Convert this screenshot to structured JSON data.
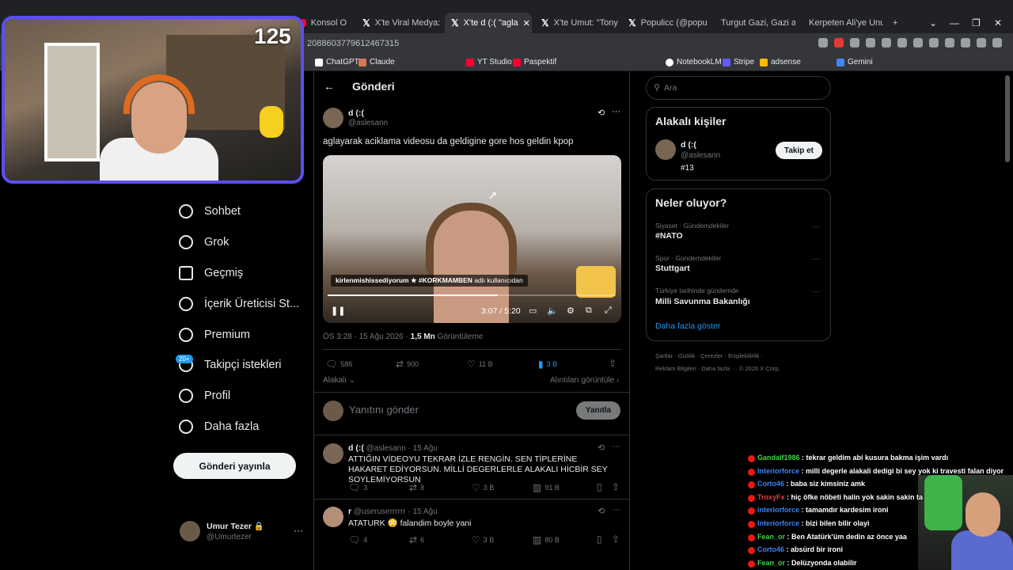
{
  "browser": {
    "tabs": [
      {
        "label": "Konsol O"
      },
      {
        "label": "X'te Viral Medya: \"Big"
      },
      {
        "label": "X'te d (:( \"agla"
      },
      {
        "label": "X'te Umut: \"Tony Sta"
      },
      {
        "label": "Populicc (@populicc)"
      },
      {
        "label": "Turgut Gazi, Gazi alp"
      },
      {
        "label": "Kerpeten Ali'ye Unutu"
      }
    ],
    "new_tab": "+",
    "url": "2088603779612467315",
    "bookmarks": [
      "ChatGPT",
      "Claude",
      "YT Studio",
      "Paspektif",
      "NotebookLM",
      "Stripe",
      "adsense",
      "Gemini"
    ]
  },
  "stream": {
    "counter": "125",
    "chat": [
      {
        "user": "Gandalf1986",
        "msg": ": tekrar geldim abi kusura bakma işim vardı",
        "color": "#3fd34a"
      },
      {
        "user": "Interiorforce",
        "msg": ": milli degerle alakali dedigi bi sey yok ki travesti falan diyor",
        "color": "#3b82f6"
      },
      {
        "user": "Corto46",
        "msg": ": baba siz kimsiniz amk",
        "color": "#3b82f6"
      },
      {
        "user": "TroxyFx",
        "msg": ": hiç öfke nöbeti halin yok sakin sakin ta",
        "color": "#e04040"
      },
      {
        "user": "interiorforce",
        "msg": ": tamamdır kardesim ironi",
        "color": "#3b82f6"
      },
      {
        "user": "Interiorforce",
        "msg": ": bizi bilen bilir olayi",
        "color": "#3b82f6"
      },
      {
        "user": "Fean_or",
        "msg": ": Ben Atatürk'üm dedin az önce yaa",
        "color": "#3fd34a"
      },
      {
        "user": "Corto46",
        "msg": ": absürd bir ironi",
        "color": "#3b82f6"
      },
      {
        "user": "Fean_or",
        "msg": ": Delüzyonda olabilir",
        "color": "#3fd34a"
      }
    ]
  },
  "nav": {
    "items": [
      "Sohbet",
      "Grok",
      "Geçmiş",
      "İçerik Üreticisi St...",
      "Premium",
      "Takipçi istekleri",
      "Profil",
      "Daha fazla"
    ],
    "badge": "20+",
    "post_button": "Gönderi yayınla",
    "account": {
      "name": "Umur Tezer 🔒",
      "handle": "@Umurtezer",
      "more": "···"
    }
  },
  "main": {
    "back": "←",
    "title": "Gönderi",
    "tweet": {
      "name": "d (:(",
      "handle": "@aslesann",
      "text": "aglayarak aciklama videosu da geldigine gore hos geldin kpop",
      "video": {
        "caption_prefix": "kirlenmishissediyorum ★ #KORKMAMBEN",
        "caption_suffix": "adlı kullanıcıdan",
        "time": "3:07 / 5:20",
        "progress": 0.59
      },
      "timestamp": "ÖS 3:28 · 15 Ağu 2026 ·",
      "views_count": "1,5 Mn",
      "views_label": "Görüntüleme",
      "stats": {
        "replies": "586",
        "retweets": "900",
        "likes": "11 B",
        "bookmarks": "3 B"
      },
      "related": "Alakalı",
      "quotes": "Alıntıları görüntüle"
    },
    "reply_placeholder": "Yanıtını gönder",
    "reply_button": "Yanıtla",
    "replies": [
      {
        "name": "d (:(",
        "handle": "@aslesann · 15 Ağu",
        "text": "ATTIĞIN VİDEOYU TEKRAR İZLE RENGİN. SEN TİPLERİNE HAKARET EDİYORSUN. MİLLİ DEGERLERLE ALAKALI HİCBİR SEY SOYLEMİYORSUN",
        "stats": {
          "replies": "3",
          "retweets": "8",
          "likes": "3 B",
          "views": "91 B"
        }
      },
      {
        "name": "r",
        "handle": "@useruserrrrrr · 15 Ağu",
        "text": "ATATURK 😳 falandim boyle yani",
        "stats": {
          "replies": "4",
          "retweets": "6",
          "likes": "3 B",
          "views": "80 B"
        }
      }
    ]
  },
  "right": {
    "search_placeholder": "Ara",
    "relevant_title": "Alakalı kişiler",
    "person": {
      "name": "d (:(",
      "handle": "@aslesann",
      "bio": "#13",
      "follow": "Takip et"
    },
    "trends_title": "Neler oluyor?",
    "trends": [
      {
        "category": "Siyaset · Gündemdekiler",
        "name": "#NATO"
      },
      {
        "category": "Spor · Gündemdekiler",
        "name": "Stuttgart"
      },
      {
        "category": "Türkiye tarihinde gündemde",
        "name": "Milli Savunma Bakanlığı"
      }
    ],
    "show_more": "Daha fazla göster",
    "footer1": "Şartlar  ·  Gizlilik  ·  Çerezler  ·  Erişilebilirlik  ·",
    "footer2": "Reklam Bilgileri  ·  Daha fazla ···  © 2026 X Corp."
  },
  "colors": {
    "accent": "#1d9bf0",
    "cam_border": "#5a4ff0",
    "bg": "#000000"
  }
}
